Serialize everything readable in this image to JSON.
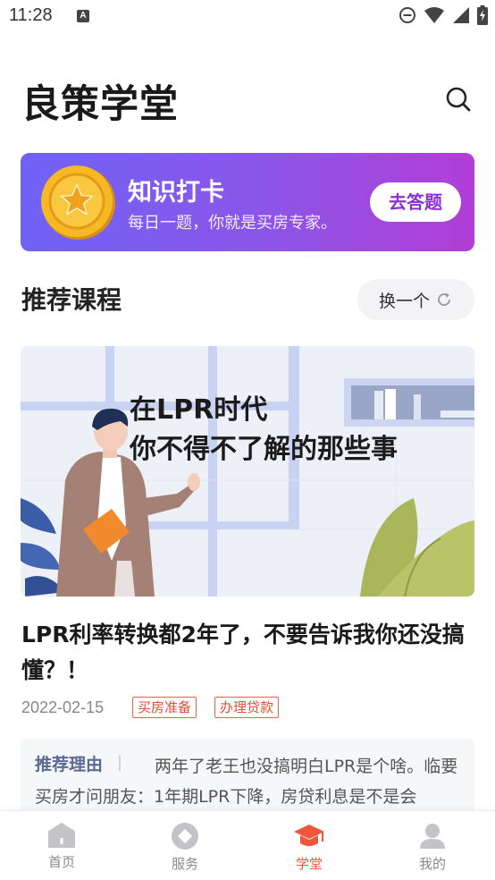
{
  "status_bar": {
    "time": "11:28",
    "icons": [
      "a-notification-icon",
      "dnd-icon",
      "wifi-icon",
      "signal-icon",
      "battery-charging-icon"
    ]
  },
  "header": {
    "title": "良策学堂",
    "search_icon": "search-icon"
  },
  "banner": {
    "title": "知识打卡",
    "subtitle": "每日一题，你就是买房专家。",
    "button": "去答题",
    "icon": "gold-star-coin-icon"
  },
  "section": {
    "title": "推荐课程",
    "refresh_label": "换一个",
    "refresh_icon": "refresh-icon"
  },
  "course": {
    "image_text_line1": "在LPR时代",
    "image_text_line2": "你不得不了解的那些事",
    "title": "LPR利率转换都2年了，不要告诉我你还没搞懂？！",
    "date": "2022-02-15",
    "tags": [
      "买房准备",
      "办理贷款"
    ],
    "reason_label": "推荐理由",
    "reason_separator": "|",
    "reason_text": "两年了老王也没搞明白LPR是个啥。临要买房才问朋友：1年期LPR下降，房贷利息是不是会"
  },
  "bottom_nav": {
    "active_index": 2,
    "active_color": "#f0563c",
    "items": [
      {
        "label": "首页",
        "icon": "home-icon"
      },
      {
        "label": "服务",
        "icon": "service-icon"
      },
      {
        "label": "学堂",
        "icon": "graduation-cap-icon"
      },
      {
        "label": "我的",
        "icon": "person-icon"
      }
    ]
  }
}
